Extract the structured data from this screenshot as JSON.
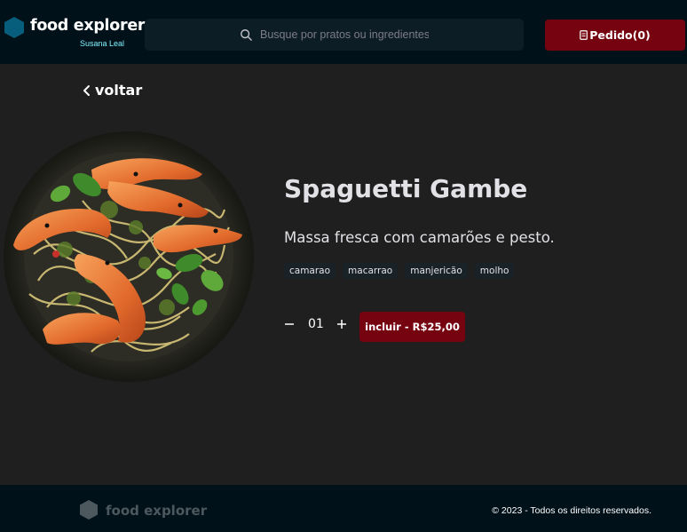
{
  "header": {
    "brand_name": "food explorer",
    "brand_icon": "hexagon-logo-icon",
    "user_name": "Susana Leal",
    "search": {
      "placeholder": "Busque por pratos ou ingredientes",
      "value": "",
      "icon": "search-icon"
    },
    "order_button": {
      "label": "Pedido(0)",
      "icon": "receipt-icon"
    },
    "colors": {
      "background": "#00111a",
      "brand_accent": "#065e7c",
      "user_name": "#82f3ff",
      "order_button": "#750310"
    }
  },
  "back_link": {
    "label": "voltar",
    "icon": "chevron-left-icon"
  },
  "dish": {
    "image": "dish-photo-spaghetti-shrimp",
    "title": "Spaguetti Gambe",
    "description": "Massa fresca com camarões e pesto.",
    "ingredients": [
      "camarao",
      "macarrao",
      "manjericão",
      "molho"
    ],
    "quantity": "01",
    "include_button": "incluir - R$25,00"
  },
  "footer": {
    "brand_name": "food explorer",
    "brand_icon": "hexagon-logo-icon",
    "copyright": "© 2023 - Todos os direitos reservados."
  }
}
